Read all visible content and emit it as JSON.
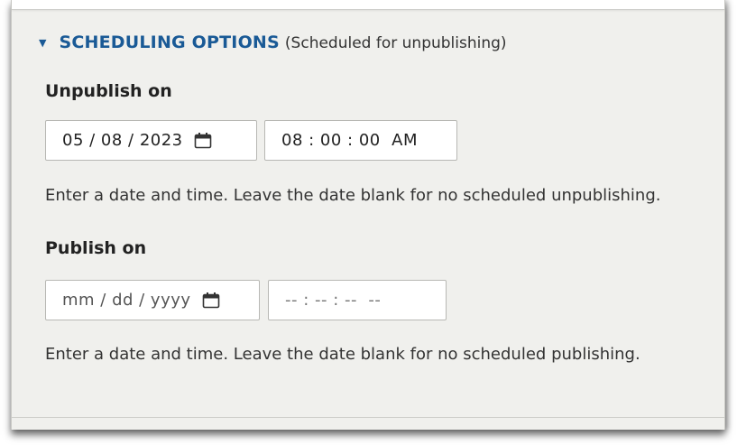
{
  "section": {
    "toggle_glyph": "▼",
    "title": "SCHEDULING OPTIONS",
    "status": "(Scheduled for unpublishing)",
    "accent_color": "#1a5a96"
  },
  "unpublish": {
    "label": "Unpublish on",
    "date_value": "05 / 08 / 2023",
    "time_value": "08 : 00 : 00  AM",
    "description": "Enter a date and time. Leave the date blank for no scheduled unpublishing."
  },
  "publish": {
    "label": "Publish on",
    "date_placeholder": "mm / dd / yyyy",
    "time_placeholder": "-- : -- : --  --",
    "description": "Enter a date and time. Leave the date blank for no scheduled publishing."
  },
  "icons": {
    "calendar": "calendar-icon"
  }
}
